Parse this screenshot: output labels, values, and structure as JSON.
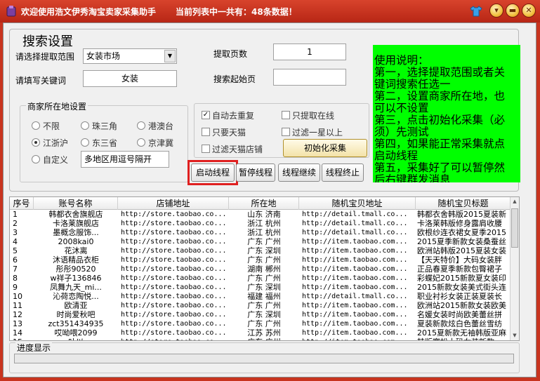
{
  "window": {
    "title": "欢迎使用浩文伊秀淘宝卖家采集助手",
    "count_text": "当前列表中一共有：48条数据！"
  },
  "search": {
    "group_title": "搜索设置",
    "scope_label": "请选择提取范围",
    "scope_value": "女装市场",
    "keyword_label": "请填写关键词",
    "keyword_value": "女装",
    "pages_label": "提取页数",
    "pages_value": "1",
    "start_page_label": "搜索起始页",
    "start_page_value": ""
  },
  "merchant": {
    "title": "商家所在地设置",
    "options": [
      {
        "label": "不限",
        "selected": false
      },
      {
        "label": "珠三角",
        "selected": false
      },
      {
        "label": "港澳台",
        "selected": false
      },
      {
        "label": "江浙沪",
        "selected": true
      },
      {
        "label": "东三省",
        "selected": false
      },
      {
        "label": "京津冀",
        "selected": false
      },
      {
        "label": "自定义",
        "selected": false
      }
    ],
    "custom_placeholder": "多地区用逗号隔开"
  },
  "options": {
    "auto_dedupe": {
      "label": "自动去重复",
      "checked": true
    },
    "only_online": {
      "label": "只提取在线",
      "checked": false
    },
    "only_tmall": {
      "label": "只要天猫",
      "checked": false
    },
    "filter_one_star": {
      "label": "过滤一星以上",
      "checked": false
    },
    "filter_tmall_shop": {
      "label": "过滤天猫店铺",
      "checked": false
    }
  },
  "buttons": {
    "init": "初始化采集",
    "start": "启动线程",
    "pause": "暂停线程",
    "resume": "线程继续",
    "stop": "线程终止"
  },
  "help": {
    "lines": [
      "使用说明：",
      "第一，选择提取范围或者关",
      "键词搜索任选一",
      "第二，设置商家所在地，也",
      "可以不设置",
      "第三，点击初始化采集（必",
      "须）先测试",
      "第四，如果能正常采集就点",
      "启动线程",
      "第五，采集好了可以暂停然",
      "后右键群发消息"
    ]
  },
  "table": {
    "headers": [
      "序号",
      "账号名称",
      "店铺地址",
      "所在地",
      "随机宝贝地址",
      "随机宝贝标题"
    ],
    "rows": [
      [
        "1",
        "韩都衣舍旗舰店",
        "http://store.taobao.co...",
        "山东 济南",
        "http://detail.tmall.co...",
        "韩都衣舍韩版2015夏装新"
      ],
      [
        "2",
        "卡洛莱旗舰店",
        "http://store.taobao.co...",
        "浙江 杭州",
        "http://detail.tmall.co...",
        "卡洛莱韩版修身露肩收腰"
      ],
      [
        "3",
        "墨概念服饰...",
        "http://store.taobao.co...",
        "浙江 杭州",
        "http://detail.tmall.co...",
        "欧根纱连衣裙女夏季2015"
      ],
      [
        "4",
        "2008kai0",
        "http://store.taobao.co...",
        "广东 广州",
        "http://item.taobao.com...",
        "2015夏季新款女装桑蚕丝"
      ],
      [
        "5",
        "花沐离",
        "http://store.taobao.co...",
        "广东 深圳",
        "http://item.taobao.com...",
        "欧洲站韩版2015夏装女装"
      ],
      [
        "6",
        "沐语精品衣柜",
        "http://store.taobao.co...",
        "广东 广州",
        "http://item.taobao.com...",
        "【天天特价】大码女装胖"
      ],
      [
        "7",
        "彤彤90520",
        "http://store.taobao.co...",
        "湖南 郴州",
        "http://item.taobao.com...",
        "正品春夏季新款包臀裙子"
      ],
      [
        "8",
        "w祥子136846",
        "http://store.taobao.co...",
        "广东 广州",
        "http://item.taobao.com...",
        "彩蝶妃2015新款夏女装印"
      ],
      [
        "9",
        "凤舞九天_mi...",
        "http://store.taobao.co...",
        "广东 深圳",
        "http://item.taobao.com...",
        "2015新款女装美式街头连"
      ],
      [
        "10",
        "沁荷恋陶悦...",
        "http://store.taobao.co...",
        "福建 福州",
        "http://detail.tmall.co...",
        "职业衬衫女装正装夏装长"
      ],
      [
        "11",
        "欧清亚",
        "http://store.taobao.co...",
        "广东 广州",
        "http://item.taobao.com...",
        "欧洲站2015新款女装欧美"
      ],
      [
        "12",
        "时尚爱秋吧",
        "http://store.taobao.co...",
        "广东 深圳",
        "http://item.taobao.com...",
        "名媛女装时尚欧美蕾丝拼"
      ],
      [
        "13",
        "zct351434935",
        "http://store.taobao.co...",
        "广东 广州",
        "http://item.taobao.com...",
        "夏装新款炫白色蕾丝雪纺"
      ],
      [
        "14",
        "哎呦喂2099",
        "http://store.taobao.co...",
        "江苏 苏州",
        "http://item.taobao.com...",
        "2015夏新款无袖韩版亚麻"
      ],
      [
        "15",
        "一叶以...",
        "http://store.taobao.co...",
        "广东 广州",
        "http://item.taobao.com...",
        "韩版宽松大码女装新款"
      ]
    ]
  },
  "progress": {
    "label": "进度显示",
    "value": 0
  },
  "colors": {
    "titlebar": "#c8341f",
    "help_panel": "#00ff00",
    "highlight": "#e02020",
    "progress": "#3bbf3b"
  },
  "icons": [
    "app-icon",
    "shirt-skin-icon",
    "help-icon",
    "minimize-icon",
    "close-icon"
  ]
}
